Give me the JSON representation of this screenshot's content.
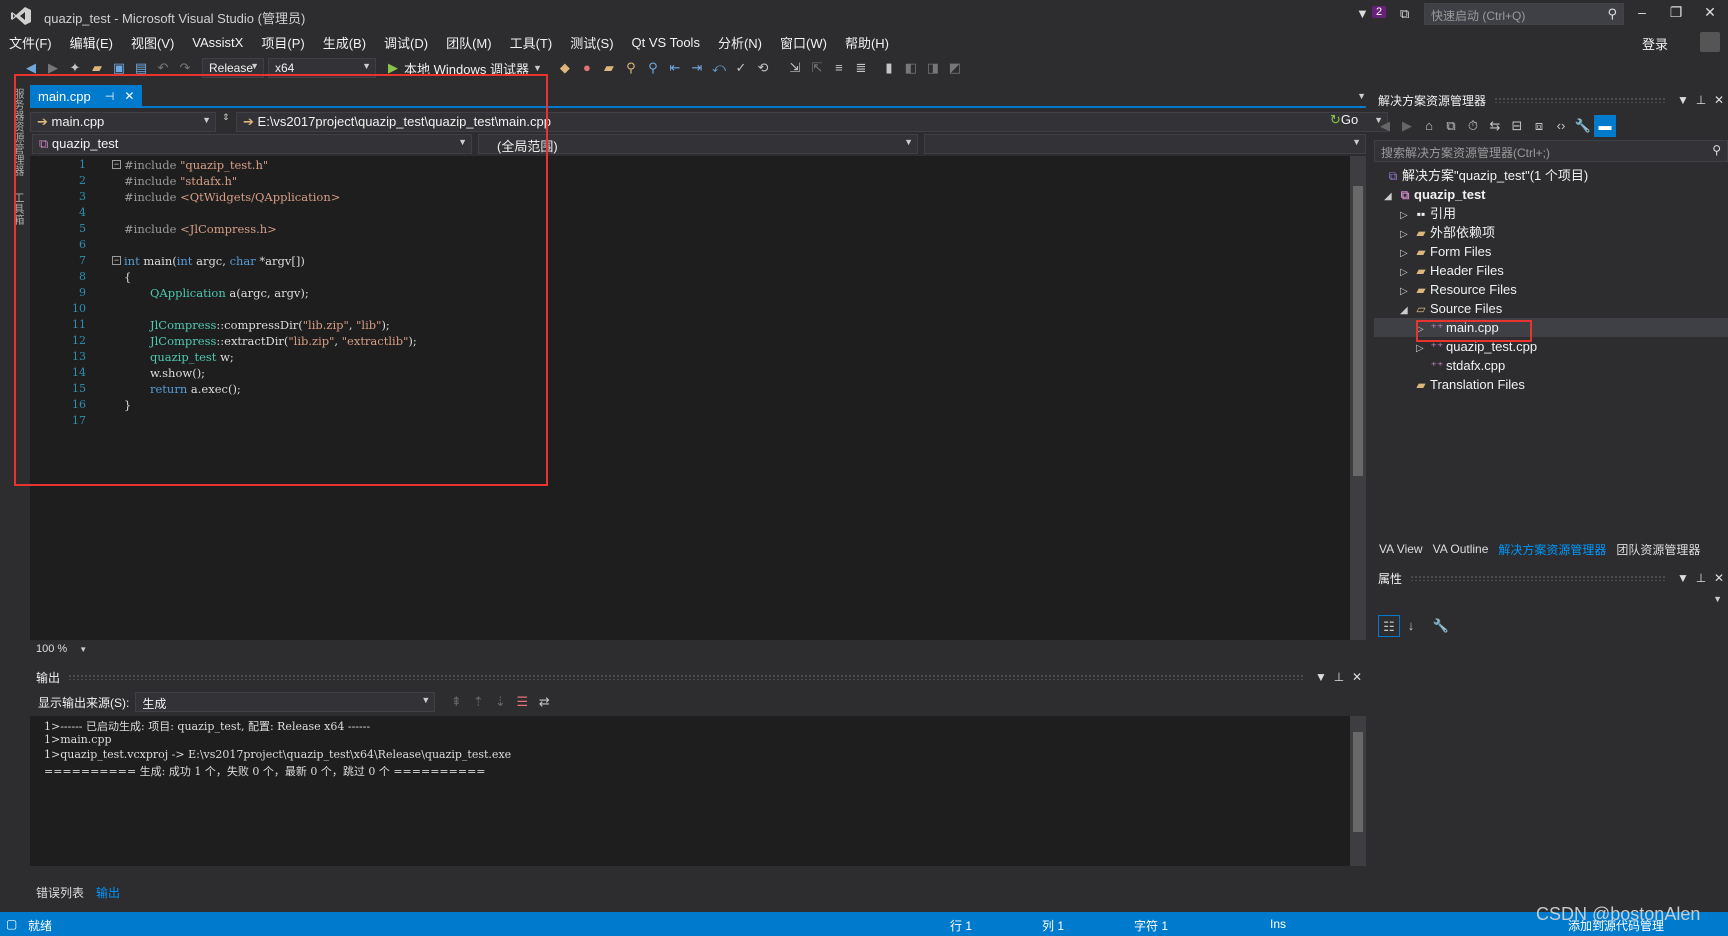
{
  "window": {
    "title": "quazip_test - Microsoft Visual Studio (管理员)",
    "notification_count": "2",
    "quicklaunch_placeholder": "快速启动 (Ctrl+Q)",
    "login": "登录"
  },
  "menu": [
    "文件(F)",
    "编辑(E)",
    "视图(V)",
    "VAssistX",
    "项目(P)",
    "生成(B)",
    "调试(D)",
    "团队(M)",
    "工具(T)",
    "测试(S)",
    "Qt VS Tools",
    "分析(N)",
    "窗口(W)",
    "帮助(H)"
  ],
  "toolbar": {
    "config": "Release",
    "platform": "x64",
    "run_label": "本地 Windows 调试器"
  },
  "left_strip": [
    "服务器资源管理器",
    "工具箱"
  ],
  "editor": {
    "tab": "main.cpp",
    "nav_file": "main.cpp",
    "nav_path": "E:\\vs2017project\\quazip_test\\quazip_test\\main.cpp",
    "go": "Go",
    "scope_project": "quazip_test",
    "scope": "(全局范围)",
    "zoom": "100 %",
    "line_numbers": [
      "1",
      "2",
      "3",
      "4",
      "5",
      "6",
      "7",
      "8",
      "9",
      "10",
      "11",
      "12",
      "13",
      "14",
      "15",
      "16",
      "17"
    ],
    "lines": {
      "l1_pp": "#include ",
      "l1_str": "\"quazip_test.h\"",
      "l2_pp": "#include ",
      "l2_str": "\"stdafx.h\"",
      "l3_pp": "#include ",
      "l3_str": "<QtWidgets/QApplication>",
      "l5_pp": "#include ",
      "l5_str": "<JlCompress.h>",
      "l7_kw1": "int",
      "l7_fn": " main(",
      "l7_kw2": "int",
      "l7_a": " argc, ",
      "l7_kw3": "char",
      "l7_b": " *argv[])",
      "l8": "{",
      "l9_ty": "QApplication",
      "l9_rest": " a(argc, argv);",
      "l11_ty": "JlCompress",
      "l11_m": "::compressDir(",
      "l11_s1": "\"lib.zip\"",
      "l11_c": ", ",
      "l11_s2": "\"lib\"",
      "l11_e": ");",
      "l12_ty": "JlCompress",
      "l12_m": "::extractDir(",
      "l12_s1": "\"lib.zip\"",
      "l12_c": ", ",
      "l12_s2": "\"extractlib\"",
      "l12_e": ");",
      "l13_ty": "quazip_test",
      "l13_rest": " w;",
      "l14": "w.show();",
      "l15_kw": "return",
      "l15_rest": " a.exec();",
      "l16": "}"
    }
  },
  "output": {
    "title": "输出",
    "source_label": "显示输出来源(S):",
    "source_value": "生成",
    "lines": [
      "1>------ 已启动生成: 项目: quazip_test, 配置: Release x64 ------",
      "1>main.cpp",
      "1>quazip_test.vcxproj -> E:\\vs2017project\\quazip_test\\x64\\Release\\quazip_test.exe",
      "========== 生成: 成功 1 个，失败 0 个，最新 0 个，跳过 0 个 =========="
    ],
    "tabs": [
      "错误列表",
      "输出"
    ]
  },
  "solution": {
    "title": "解决方案资源管理器",
    "search_placeholder": "搜索解决方案资源管理器(Ctrl+;)",
    "root": "解决方案\"quazip_test\"(1 个项目)",
    "project": "quazip_test",
    "items": [
      "引用",
      "外部依赖项",
      "Form Files",
      "Header Files",
      "Resource Files",
      "Source Files"
    ],
    "source_children": [
      "main.cpp",
      "quazip_test.cpp",
      "stdafx.cpp"
    ],
    "translation": "Translation Files",
    "tabs": [
      "VA View",
      "VA Outline",
      "解决方案资源管理器",
      "团队资源管理器"
    ]
  },
  "properties": {
    "title": "属性"
  },
  "status": {
    "ready": "就绪",
    "line": "行 1",
    "col": "列 1",
    "ch": "字符 1",
    "ins": "Ins",
    "source_control": "添加到源代码管理",
    "watermark": "CSDN @bostonAlen"
  },
  "colors": {
    "accent": "#007acc",
    "annotation_red": "#e8332f",
    "bg": "#2d2d30",
    "editor_bg": "#1e1e1e"
  }
}
